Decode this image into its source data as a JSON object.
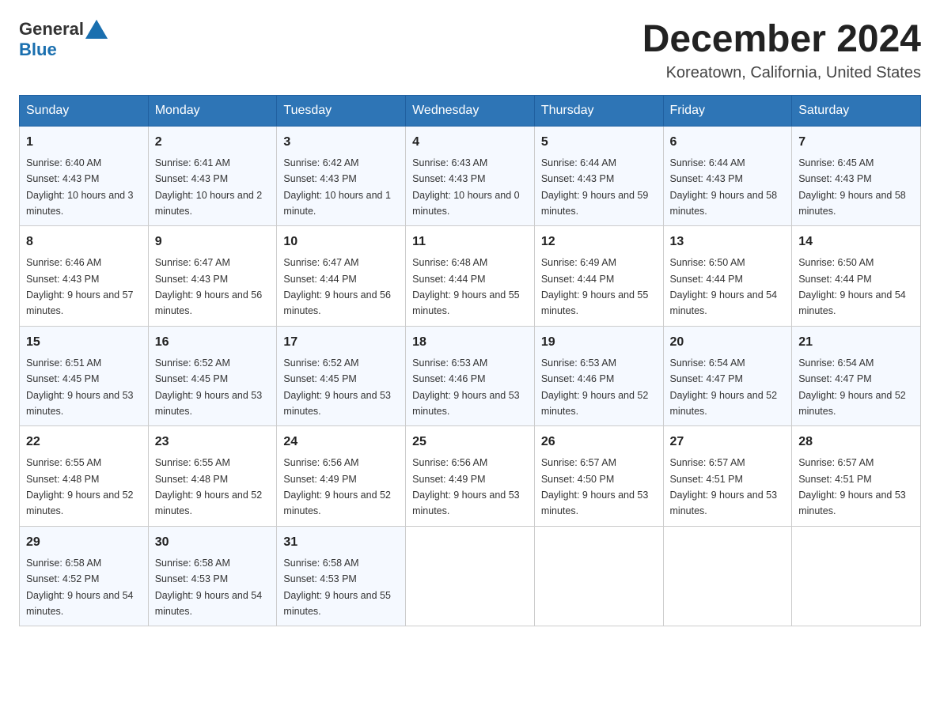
{
  "header": {
    "logo_general": "General",
    "logo_blue": "Blue",
    "title": "December 2024",
    "subtitle": "Koreatown, California, United States"
  },
  "weekdays": [
    "Sunday",
    "Monday",
    "Tuesday",
    "Wednesday",
    "Thursday",
    "Friday",
    "Saturday"
  ],
  "weeks": [
    [
      {
        "day": "1",
        "sunrise": "6:40 AM",
        "sunset": "4:43 PM",
        "daylight": "10 hours and 3 minutes."
      },
      {
        "day": "2",
        "sunrise": "6:41 AM",
        "sunset": "4:43 PM",
        "daylight": "10 hours and 2 minutes."
      },
      {
        "day": "3",
        "sunrise": "6:42 AM",
        "sunset": "4:43 PM",
        "daylight": "10 hours and 1 minute."
      },
      {
        "day": "4",
        "sunrise": "6:43 AM",
        "sunset": "4:43 PM",
        "daylight": "10 hours and 0 minutes."
      },
      {
        "day": "5",
        "sunrise": "6:44 AM",
        "sunset": "4:43 PM",
        "daylight": "9 hours and 59 minutes."
      },
      {
        "day": "6",
        "sunrise": "6:44 AM",
        "sunset": "4:43 PM",
        "daylight": "9 hours and 58 minutes."
      },
      {
        "day": "7",
        "sunrise": "6:45 AM",
        "sunset": "4:43 PM",
        "daylight": "9 hours and 58 minutes."
      }
    ],
    [
      {
        "day": "8",
        "sunrise": "6:46 AM",
        "sunset": "4:43 PM",
        "daylight": "9 hours and 57 minutes."
      },
      {
        "day": "9",
        "sunrise": "6:47 AM",
        "sunset": "4:43 PM",
        "daylight": "9 hours and 56 minutes."
      },
      {
        "day": "10",
        "sunrise": "6:47 AM",
        "sunset": "4:44 PM",
        "daylight": "9 hours and 56 minutes."
      },
      {
        "day": "11",
        "sunrise": "6:48 AM",
        "sunset": "4:44 PM",
        "daylight": "9 hours and 55 minutes."
      },
      {
        "day": "12",
        "sunrise": "6:49 AM",
        "sunset": "4:44 PM",
        "daylight": "9 hours and 55 minutes."
      },
      {
        "day": "13",
        "sunrise": "6:50 AM",
        "sunset": "4:44 PM",
        "daylight": "9 hours and 54 minutes."
      },
      {
        "day": "14",
        "sunrise": "6:50 AM",
        "sunset": "4:44 PM",
        "daylight": "9 hours and 54 minutes."
      }
    ],
    [
      {
        "day": "15",
        "sunrise": "6:51 AM",
        "sunset": "4:45 PM",
        "daylight": "9 hours and 53 minutes."
      },
      {
        "day": "16",
        "sunrise": "6:52 AM",
        "sunset": "4:45 PM",
        "daylight": "9 hours and 53 minutes."
      },
      {
        "day": "17",
        "sunrise": "6:52 AM",
        "sunset": "4:45 PM",
        "daylight": "9 hours and 53 minutes."
      },
      {
        "day": "18",
        "sunrise": "6:53 AM",
        "sunset": "4:46 PM",
        "daylight": "9 hours and 53 minutes."
      },
      {
        "day": "19",
        "sunrise": "6:53 AM",
        "sunset": "4:46 PM",
        "daylight": "9 hours and 52 minutes."
      },
      {
        "day": "20",
        "sunrise": "6:54 AM",
        "sunset": "4:47 PM",
        "daylight": "9 hours and 52 minutes."
      },
      {
        "day": "21",
        "sunrise": "6:54 AM",
        "sunset": "4:47 PM",
        "daylight": "9 hours and 52 minutes."
      }
    ],
    [
      {
        "day": "22",
        "sunrise": "6:55 AM",
        "sunset": "4:48 PM",
        "daylight": "9 hours and 52 minutes."
      },
      {
        "day": "23",
        "sunrise": "6:55 AM",
        "sunset": "4:48 PM",
        "daylight": "9 hours and 52 minutes."
      },
      {
        "day": "24",
        "sunrise": "6:56 AM",
        "sunset": "4:49 PM",
        "daylight": "9 hours and 52 minutes."
      },
      {
        "day": "25",
        "sunrise": "6:56 AM",
        "sunset": "4:49 PM",
        "daylight": "9 hours and 53 minutes."
      },
      {
        "day": "26",
        "sunrise": "6:57 AM",
        "sunset": "4:50 PM",
        "daylight": "9 hours and 53 minutes."
      },
      {
        "day": "27",
        "sunrise": "6:57 AM",
        "sunset": "4:51 PM",
        "daylight": "9 hours and 53 minutes."
      },
      {
        "day": "28",
        "sunrise": "6:57 AM",
        "sunset": "4:51 PM",
        "daylight": "9 hours and 53 minutes."
      }
    ],
    [
      {
        "day": "29",
        "sunrise": "6:58 AM",
        "sunset": "4:52 PM",
        "daylight": "9 hours and 54 minutes."
      },
      {
        "day": "30",
        "sunrise": "6:58 AM",
        "sunset": "4:53 PM",
        "daylight": "9 hours and 54 minutes."
      },
      {
        "day": "31",
        "sunrise": "6:58 AM",
        "sunset": "4:53 PM",
        "daylight": "9 hours and 55 minutes."
      },
      null,
      null,
      null,
      null
    ]
  ],
  "labels": {
    "sunrise": "Sunrise:",
    "sunset": "Sunset:",
    "daylight": "Daylight:"
  }
}
